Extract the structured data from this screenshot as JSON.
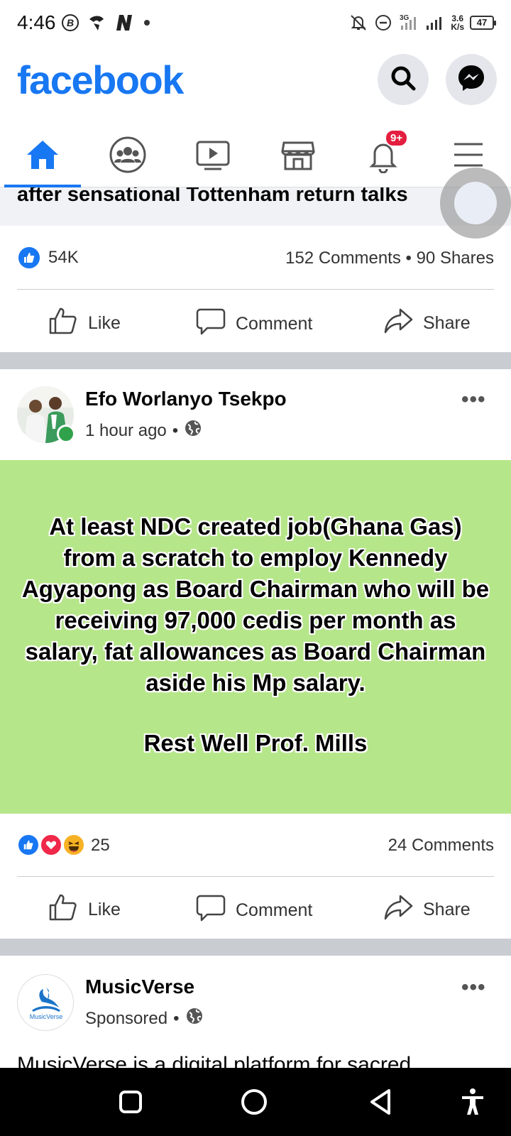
{
  "status_bar": {
    "time": "4:46",
    "network_speed_value": "3.6",
    "network_speed_unit": "K/s",
    "battery": "47",
    "icons_left": [
      "b-circle-icon",
      "signal-hook-icon",
      "n-icon",
      "dot-icon"
    ],
    "icons_right": [
      "bell-off-icon",
      "do-not-disturb-icon",
      "network-bars-icon",
      "signal-bars-icon"
    ]
  },
  "header": {
    "logo": "facebook",
    "search_icon": "search-icon",
    "messenger_icon": "messenger-icon"
  },
  "tabs": {
    "items": [
      "home",
      "groups",
      "video",
      "marketplace",
      "notifications",
      "menu"
    ],
    "active": "home",
    "notification_badge": "9+"
  },
  "post1": {
    "headline_fragment": "after sensational Tottenham return talks",
    "likes": "54K",
    "comments_shares": "152 Comments • 90 Shares",
    "actions": {
      "like": "Like",
      "comment": "Comment",
      "share": "Share"
    }
  },
  "post2": {
    "author": "Efo Worlanyo Tsekpo",
    "time": "1 hour ago",
    "privacy_sep": "•",
    "body": "At least NDC created job(Ghana Gas) from a scratch to employ Kennedy Agyapong as Board Chairman who will be receiving 97,000 cedis per month as salary, fat allowances as Board Chairman aside his Mp salary.",
    "signoff": "Rest Well Prof. Mills",
    "background_color": "#b6e68a",
    "reaction_count": "25",
    "reactions": [
      "like",
      "love",
      "haha"
    ],
    "comments": "24 Comments",
    "actions": {
      "like": "Like",
      "comment": "Comment",
      "share": "Share"
    }
  },
  "post3": {
    "author": "MusicVerse",
    "avatar_text": "MusicVerse",
    "sponsored": "Sponsored",
    "privacy_sep": "•",
    "body_fragment": "MusicVerse is a digital platform for sacred"
  },
  "colors": {
    "brand": "#1877f2",
    "online": "#31a24c",
    "badge": "#e41e3f"
  }
}
